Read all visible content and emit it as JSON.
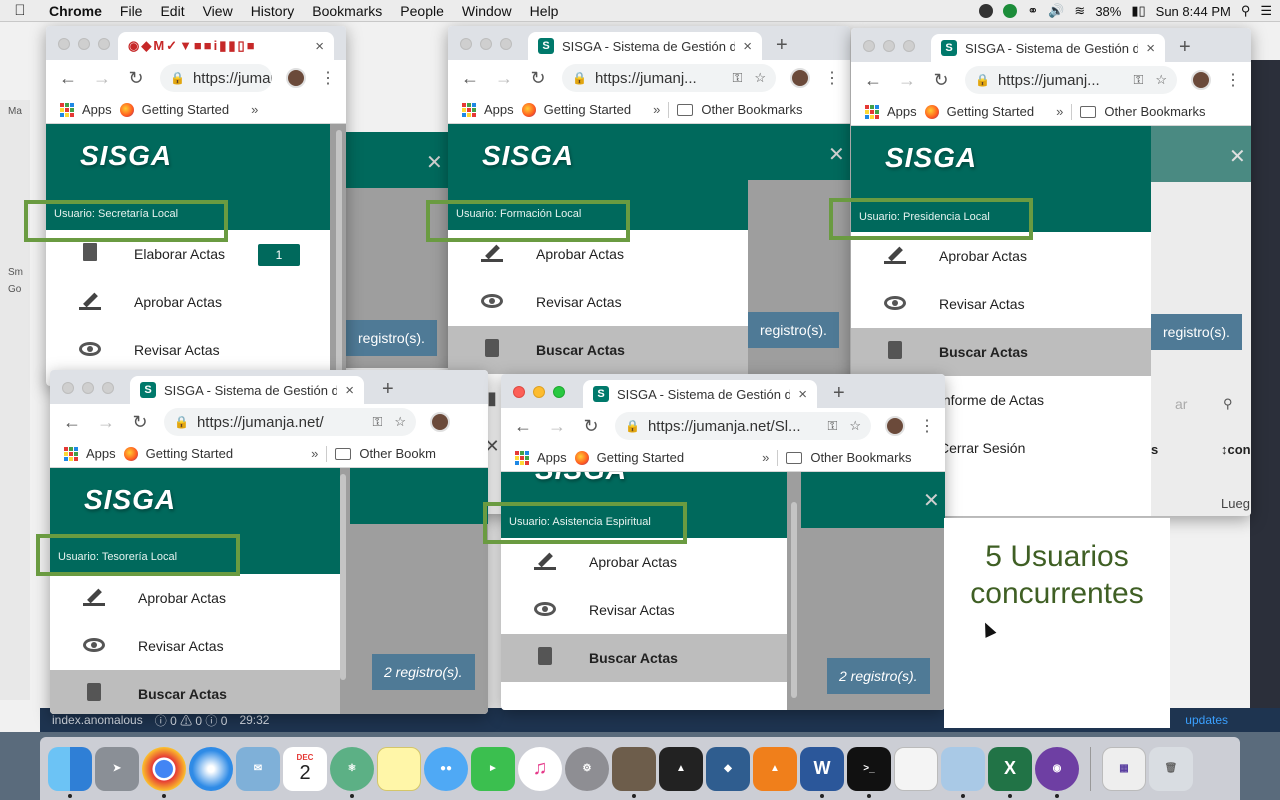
{
  "menubar": {
    "app": "Chrome",
    "items": [
      "File",
      "Edit",
      "View",
      "History",
      "Bookmarks",
      "People",
      "Window",
      "Help"
    ],
    "battery": "38%",
    "clock": "Sun 8:44 PM"
  },
  "bg_editor": {
    "left_labels": [
      "Ma",
      "Sm",
      "Go"
    ],
    "status_file": "index.anomalous",
    "status_counts": "ⓘ 0 ⚠ 0 ⓘ 0",
    "status_time": "29:32",
    "updates": "updates"
  },
  "browser": {
    "tab_title": "SISGA - Sistema de Gestión de",
    "url": "https://jumanja.net/",
    "url_short": "https://jumanj...",
    "url_mid": "https://jumanja.net/Sl...",
    "bookmarks": {
      "apps": "Apps",
      "getting_started": "Getting Started",
      "more": "»",
      "other": "Other Bookmarks",
      "other_short": "Other Bookm"
    },
    "new_tab": "+",
    "close_tab": "×"
  },
  "app": {
    "brand": "SISGA",
    "menu": {
      "elaborar": "Elaborar Actas",
      "aprobar": "Aprobar Actas",
      "revisar": "Revisar Actas",
      "buscar": "Buscar Actas",
      "informe": "Informe de Actas",
      "cerrar": "Cerrar Sesión"
    },
    "pending_badge": "1",
    "records": "2 registro(s).",
    "records_cut": "registro(s).",
    "table_header": "↕con",
    "table_header2": "s",
    "row_cell": "Lueg",
    "search_placeholder": "ar"
  },
  "windows": [
    {
      "user": "Usuario: Secretaría Local"
    },
    {
      "user": "Usuario: Formación Local"
    },
    {
      "user": "Usuario: Presidencia Local"
    },
    {
      "user": "Usuario: Tesorería Local"
    },
    {
      "user": "Usuario: Asistencia Espiritual"
    }
  ],
  "annotation": {
    "line1": "5 Usuarios",
    "line2": "concurrentes"
  },
  "dock": {
    "apps": [
      "Finder",
      "Launchpad",
      "Chrome",
      "Safari",
      "Mail",
      "Calendar",
      "Atom",
      "Notes",
      "Messages",
      "FaceTime",
      "iTunes",
      "System Preferences",
      "GIMP",
      "Inkscape",
      "Sourcetree",
      "VLC",
      "Word",
      "Terminal",
      "TextEdit",
      "Preview",
      "Excel",
      "GitHub",
      "Collab",
      "Trash"
    ],
    "calendar_month": "DEC",
    "calendar_day": "2"
  },
  "colors": {
    "teal": "#00695c",
    "highlight": "#6a9b41",
    "annotation_text": "#3f5f24"
  }
}
